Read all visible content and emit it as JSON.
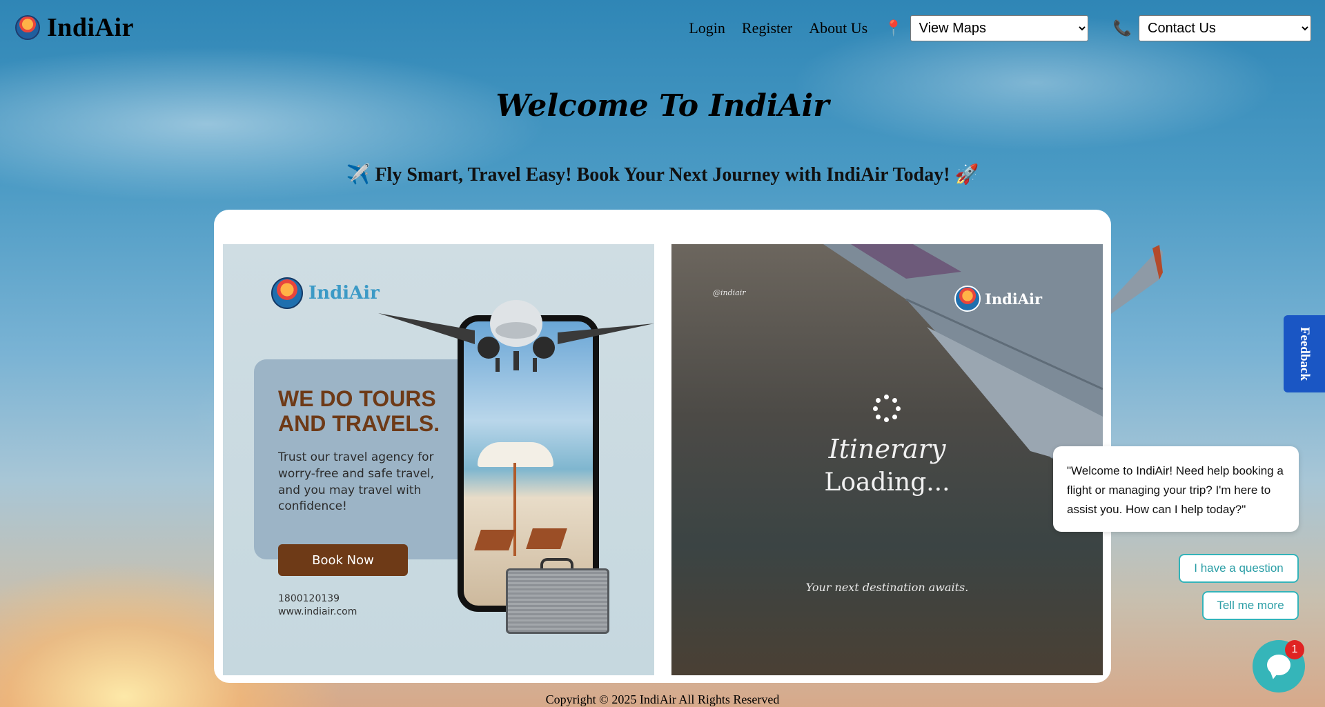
{
  "brand": {
    "name": "IndiAir",
    "logo_icon": "indiair-logo-icon"
  },
  "nav": {
    "links": [
      "Login",
      "Register",
      "About Us"
    ],
    "maps_icon": "map-pin-icon",
    "maps_select": {
      "selected": "View Maps"
    },
    "contact_icon": "phone-icon",
    "contact_select": {
      "selected": "Contact Us"
    }
  },
  "hero": {
    "title": "Welcome To IndiAir",
    "tagline": "Fly Smart, Travel Easy! Book Your Next Journey with IndiAir Today!",
    "tagline_icons": [
      "airplane-icon",
      "rocket-icon"
    ]
  },
  "ad_left": {
    "logo_text": "IndiAir",
    "heading": "WE DO TOURS AND TRAVELS.",
    "body": "Trust our travel agency for worry-free and safe travel, and you may travel with confidence!",
    "button": "Book Now",
    "phone": "1800120139",
    "website": "www.indiair.com"
  },
  "ad_right": {
    "handle": "@indiair",
    "logo_text": "IndiAir",
    "title_line1": "Itinerary",
    "title_line2": "Loading...",
    "subtitle": "Your next destination awaits."
  },
  "feedback_tab": {
    "label": "Feedback"
  },
  "chat": {
    "message": "\"Welcome to IndiAir! Need help booking a flight or managing your trip? I'm here to assist you. How can I help today?\"",
    "quick_replies": [
      "I have a question",
      "Tell me more"
    ],
    "unread_count": "1",
    "launcher_icon": "chat-icon"
  },
  "footer": {
    "copyright": "Copyright © 2025 IndiAir All Rights Reserved"
  },
  "colors": {
    "accent_brown": "#6e3a17",
    "feedback_blue": "#1a56c4",
    "chat_teal": "#35b5b9",
    "badge_red": "#e02323",
    "logo_blue": "#3c9ac6"
  }
}
